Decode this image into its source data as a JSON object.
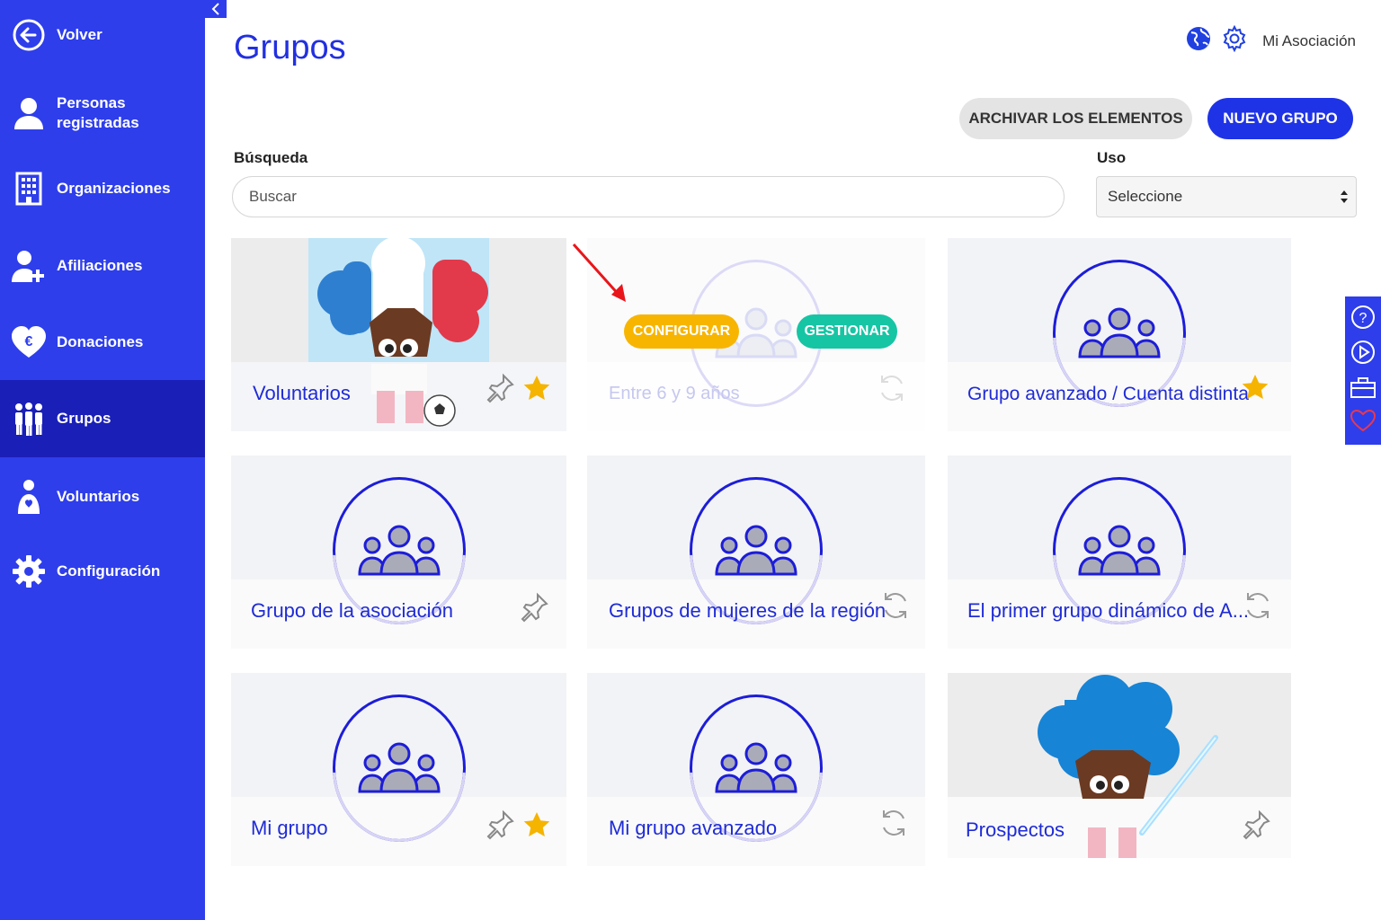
{
  "sidebar": {
    "items": [
      {
        "label": "Volver",
        "icon": "back-arrow-icon"
      },
      {
        "label": "Personas\nregistradas",
        "icon": "person-icon"
      },
      {
        "label": "Organizaciones",
        "icon": "building-icon"
      },
      {
        "label": "Afiliaciones",
        "icon": "person-plus-icon"
      },
      {
        "label": "Donaciones",
        "icon": "heart-euro-icon"
      },
      {
        "label": "Grupos",
        "icon": "people-group-icon",
        "active": true
      },
      {
        "label": "Voluntarios",
        "icon": "volunteer-icon"
      },
      {
        "label": "Configuración",
        "icon": "gear-icon"
      }
    ]
  },
  "header": {
    "title": "Grupos",
    "org_name": "Mi Asociación",
    "archive_label": "ARCHIVAR LOS ELEMENTOS",
    "new_group_label": "NUEVO GRUPO"
  },
  "filters": {
    "search_label": "Búsqueda",
    "search_placeholder": "Buscar",
    "use_label": "Uso",
    "use_selected": "Seleccione"
  },
  "cards": [
    {
      "name": "Voluntarios",
      "image": "mascot-france",
      "pinned": true,
      "starred": true
    },
    {
      "name": "Entre 6 y 9 años",
      "hover": true,
      "configure_label": "CONFIGURAR",
      "manage_label": "GESTIONAR",
      "dynamic": true
    },
    {
      "name": "Grupo avanzado / Cuenta distinta",
      "starred": true
    },
    {
      "name": "Grupo de la asociación",
      "pinned": true
    },
    {
      "name": "Grupos de mujeres de la región",
      "dynamic": true
    },
    {
      "name": "El primer grupo dinámico de A...",
      "dynamic": true
    },
    {
      "name": "Mi grupo",
      "pinned": true,
      "starred": true
    },
    {
      "name": "Mi grupo avanzado",
      "dynamic": true
    },
    {
      "name": "Prospectos",
      "image": "mascot-blue",
      "pinned": true
    }
  ],
  "colors": {
    "sidebar": "#2e3eeb",
    "accent": "#1f33e6",
    "configure": "#f7b500",
    "manage": "#16c5a4",
    "star": "#f5b400"
  }
}
